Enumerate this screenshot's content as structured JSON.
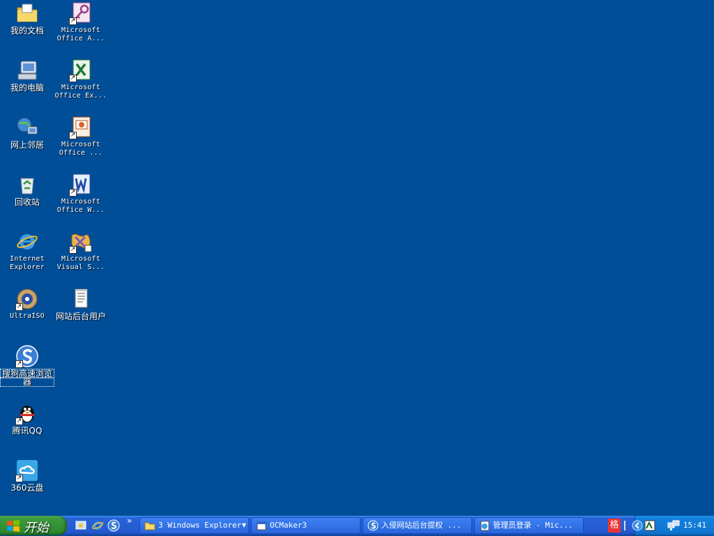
{
  "desktop": {
    "col1": [
      {
        "label": "我的文档"
      },
      {
        "label": "我的电脑"
      },
      {
        "label": "网上邻居"
      },
      {
        "label": "回收站"
      },
      {
        "label1": "Internet",
        "label2": "Explorer"
      },
      {
        "label": "UltraISO"
      },
      {
        "label1": "搜狗高速浏览",
        "label2": "器"
      },
      {
        "label": "腾讯QQ"
      },
      {
        "label": "360云盘"
      }
    ],
    "col2": [
      {
        "label1": "Microsoft",
        "label2": "Office A..."
      },
      {
        "label1": "Microsoft",
        "label2": "Office Ex..."
      },
      {
        "label1": "Microsoft",
        "label2": "Office ..."
      },
      {
        "label1": "Microsoft",
        "label2": "Office W..."
      },
      {
        "label1": "Microsoft",
        "label2": "Visual S..."
      },
      {
        "label": "网站后台用户"
      }
    ]
  },
  "taskbar": {
    "start_label": "开始",
    "quick_more": "»",
    "tasks": [
      {
        "label": "3 Windows Explorer",
        "caret": "▼"
      },
      {
        "label": "OCMaker3"
      },
      {
        "label": "入侵网站后台提权 ..."
      },
      {
        "label": "管理员登录 - Mic..."
      }
    ],
    "ime_label": "格"
  },
  "tray": {
    "time": "15:41"
  }
}
